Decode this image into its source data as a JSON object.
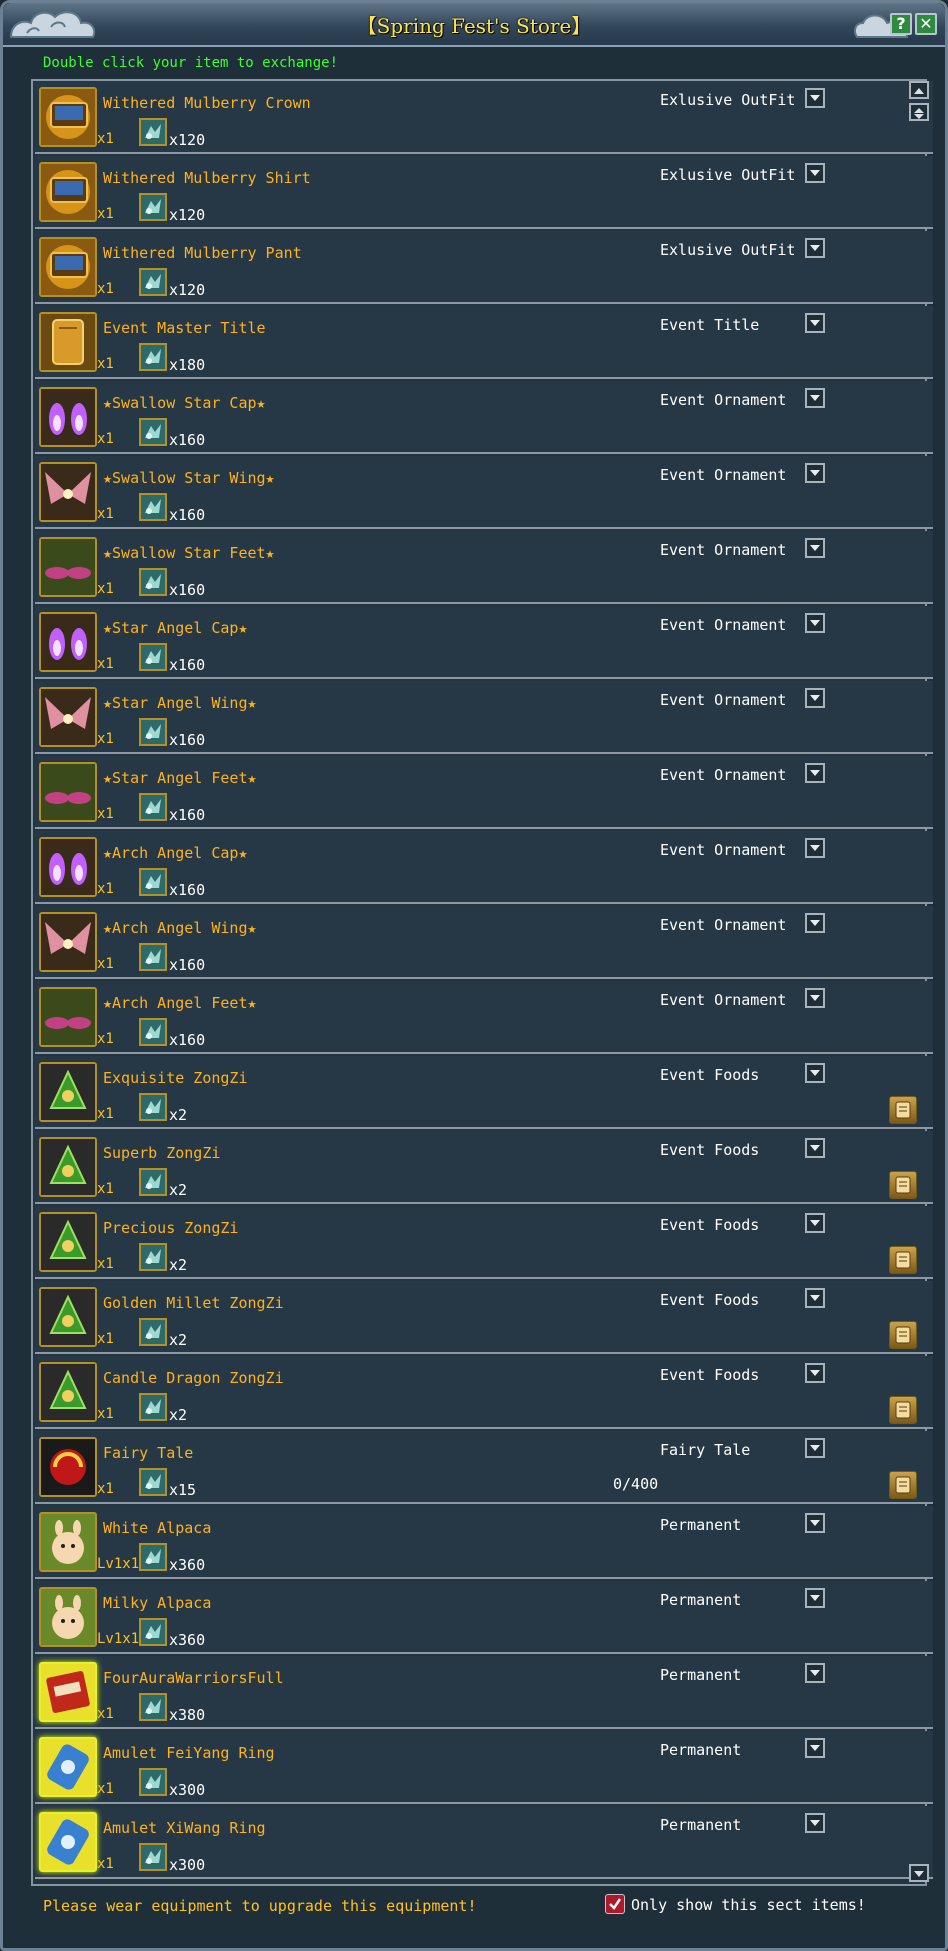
{
  "window": {
    "title": "【Spring Fest's Store】",
    "help_label": "?",
    "close_label": "✕"
  },
  "hint": "Double click your item to exchange!",
  "footer": {
    "notice": "Please wear equipment to upgrade this equipment!",
    "sect_filter_label": "Only show this sect items!",
    "sect_filter_checked": true
  },
  "colors": {
    "title": "#ffe14a",
    "hint": "#3cff2e",
    "item_name": "#ffb21a",
    "panel_bg": "#1f2f39",
    "row_divider": "#8c98a3"
  },
  "items": [
    {
      "name": "Withered Mulberry Crown",
      "qty": "x1",
      "cost": "x120",
      "category": "Exlusive OutFit",
      "icon": "chest-icon"
    },
    {
      "name": "Withered Mulberry Shirt",
      "qty": "x1",
      "cost": "x120",
      "category": "Exlusive OutFit",
      "icon": "chest-icon"
    },
    {
      "name": "Withered Mulberry Pant",
      "qty": "x1",
      "cost": "x120",
      "category": "Exlusive OutFit",
      "icon": "chest-icon"
    },
    {
      "name": "Event Master Title",
      "qty": "x1",
      "cost": "x180",
      "category": "Event Title",
      "icon": "title-scroll-icon"
    },
    {
      "name": "★Swallow Star Cap★",
      "qty": "x1",
      "cost": "x160",
      "category": "Event Ornament",
      "icon": "ornament-cap-icon"
    },
    {
      "name": "★Swallow Star Wing★",
      "qty": "x1",
      "cost": "x160",
      "category": "Event Ornament",
      "icon": "ornament-wing-icon"
    },
    {
      "name": "★Swallow Star Feet★",
      "qty": "x1",
      "cost": "x160",
      "category": "Event Ornament",
      "icon": "ornament-feet-icon"
    },
    {
      "name": "★Star Angel Cap★",
      "qty": "x1",
      "cost": "x160",
      "category": "Event Ornament",
      "icon": "ornament-cap-icon"
    },
    {
      "name": "★Star Angel Wing★",
      "qty": "x1",
      "cost": "x160",
      "category": "Event Ornament",
      "icon": "ornament-wing-icon"
    },
    {
      "name": "★Star Angel Feet★",
      "qty": "x1",
      "cost": "x160",
      "category": "Event Ornament",
      "icon": "ornament-feet-icon"
    },
    {
      "name": "★Arch Angel Cap★",
      "qty": "x1",
      "cost": "x160",
      "category": "Event Ornament",
      "icon": "ornament-cap-icon"
    },
    {
      "name": "★Arch Angel Wing★",
      "qty": "x1",
      "cost": "x160",
      "category": "Event Ornament",
      "icon": "ornament-wing-icon"
    },
    {
      "name": "★Arch Angel Feet★",
      "qty": "x1",
      "cost": "x160",
      "category": "Event Ornament",
      "icon": "ornament-feet-icon"
    },
    {
      "name": "Exquisite ZongZi",
      "qty": "x1",
      "cost": "x2",
      "category": "Event Foods",
      "icon": "zongzi-icon",
      "info": true
    },
    {
      "name": "Superb ZongZi",
      "qty": "x1",
      "cost": "x2",
      "category": "Event Foods",
      "icon": "zongzi-icon",
      "info": true
    },
    {
      "name": "Precious ZongZi",
      "qty": "x1",
      "cost": "x2",
      "category": "Event Foods",
      "icon": "zongzi-icon",
      "info": true
    },
    {
      "name": "Golden Millet ZongZi",
      "qty": "x1",
      "cost": "x2",
      "category": "Event Foods",
      "icon": "zongzi-icon",
      "info": true
    },
    {
      "name": "Candle Dragon ZongZi",
      "qty": "x1",
      "cost": "x2",
      "category": "Event Foods",
      "icon": "zongzi-icon",
      "info": true
    },
    {
      "name": "Fairy Tale",
      "qty": "x1",
      "cost": "x15",
      "category": "Fairy Tale",
      "icon": "fairy-tale-icon",
      "info": true,
      "limit": "0/400"
    },
    {
      "name": "White Alpaca",
      "qty": "Lv1x1",
      "cost": "x360",
      "category": "Permanent",
      "icon": "alpaca-icon"
    },
    {
      "name": "Milky Alpaca",
      "qty": "Lv1x1",
      "cost": "x360",
      "category": "Permanent",
      "icon": "alpaca-icon"
    },
    {
      "name": "FourAuraWarriorsFull",
      "qty": "x1",
      "cost": "x380",
      "category": "Permanent",
      "icon": "book-icon",
      "glow": true
    },
    {
      "name": "Amulet FeiYang Ring",
      "qty": "x1",
      "cost": "x300",
      "category": "Permanent",
      "icon": "ring-icon",
      "glow": true
    },
    {
      "name": "Amulet XiWang Ring",
      "qty": "x1",
      "cost": "x300",
      "category": "Permanent",
      "icon": "ring-icon",
      "glow": true
    }
  ]
}
